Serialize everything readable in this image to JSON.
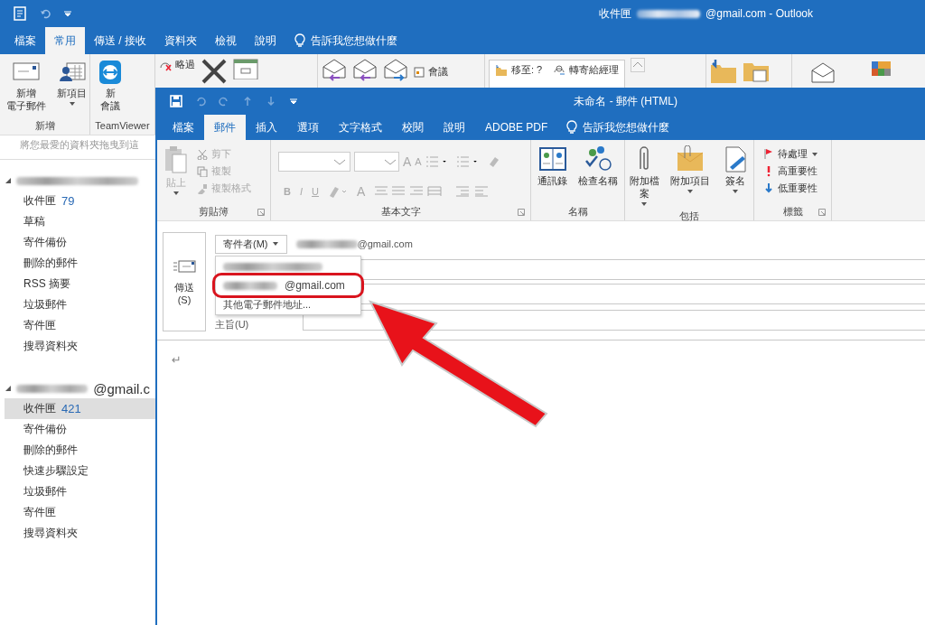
{
  "outlook": {
    "title": {
      "folder": "收件匣",
      "account": "@gmail.com - Outlook"
    },
    "tabs": [
      {
        "label": "檔案",
        "selected": false
      },
      {
        "label": "常用",
        "selected": true
      },
      {
        "label": "傳送 / 接收",
        "selected": false
      },
      {
        "label": "資料夾",
        "selected": false
      },
      {
        "label": "檢視",
        "selected": false
      },
      {
        "label": "說明",
        "selected": false
      }
    ],
    "tell_me": "告訴我您想做什麼",
    "ribbon": {
      "groups": [
        {
          "kind": "new",
          "label": "新增",
          "buttons": [
            {
              "kind": "mail",
              "label_lines": [
                "新增",
                "電子郵件"
              ],
              "menu": false
            },
            {
              "kind": "item",
              "label_lines": [
                "新項目"
              ],
              "menu": true
            }
          ]
        },
        {
          "kind": "teamviewer",
          "label": "TeamViewer",
          "buttons": [
            {
              "kind": "meeting",
              "label_lines": [
                "新",
                "會議"
              ],
              "menu": false
            }
          ]
        }
      ],
      "ignore": "略過",
      "meeting": "會議",
      "quick_steps": [
        "移至: ?",
        "轉寄給經理"
      ]
    },
    "favorites_hint": "將您最愛的資料夾拖曳到這",
    "accounts": [
      {
        "expanded": true,
        "folders": [
          {
            "name": "收件匣",
            "count": "79",
            "selected": false
          },
          {
            "name": "草稿",
            "selected": false
          },
          {
            "name": "寄件備份",
            "selected": false
          },
          {
            "name": "刪除的郵件",
            "selected": false
          },
          {
            "name": "RSS 摘要",
            "selected": false
          },
          {
            "name": "垃圾郵件",
            "selected": false
          },
          {
            "name": "寄件匣",
            "selected": false
          },
          {
            "name": "搜尋資料夾",
            "selected": false
          }
        ]
      },
      {
        "expanded": true,
        "name": "@gmail.c",
        "folders": [
          {
            "name": "收件匣",
            "count": "421",
            "selected": true
          },
          {
            "name": "寄件備份",
            "selected": false
          },
          {
            "name": "刪除的郵件",
            "selected": false
          },
          {
            "name": "快速步驟設定",
            "selected": false
          },
          {
            "name": "垃圾郵件",
            "selected": false
          },
          {
            "name": "寄件匣",
            "selected": false
          },
          {
            "name": "搜尋資料夾",
            "selected": false
          }
        ]
      }
    ]
  },
  "compose": {
    "title": "未命名 - 郵件 (HTML)",
    "tabs": [
      {
        "label": "檔案",
        "selected": false
      },
      {
        "label": "郵件",
        "selected": true
      },
      {
        "label": "插入",
        "selected": false
      },
      {
        "label": "選項",
        "selected": false
      },
      {
        "label": "文字格式",
        "selected": false
      },
      {
        "label": "校閱",
        "selected": false
      },
      {
        "label": "說明",
        "selected": false
      },
      {
        "label": "ADOBE PDF",
        "selected": false
      }
    ],
    "tell_me": "告訴我您想做什麼",
    "clipboard": {
      "label": "剪貼簿",
      "disabled": true,
      "paste": "貼上",
      "actions": [
        "剪下",
        "複製",
        "複製格式"
      ]
    },
    "basic_text": {
      "label": "基本文字",
      "disabled": true,
      "grow": "A",
      "shrink": "A",
      "styles": [
        "B",
        "I",
        "U"
      ],
      "font_color": "A"
    },
    "names": {
      "label": "名稱",
      "buttons": [
        "通訊錄",
        "檢查名稱"
      ]
    },
    "include": {
      "label": "包括",
      "buttons": [
        {
          "label_lines": [
            "附加檔",
            "案"
          ],
          "menu": true
        },
        {
          "label_lines": [
            "附加項目"
          ],
          "menu": true
        },
        {
          "label_lines": [
            "簽名"
          ],
          "menu": true
        }
      ]
    },
    "tags": {
      "label": "標籤",
      "items": [
        {
          "kind": "flag",
          "label": "待處理",
          "menu": true
        },
        {
          "kind": "high",
          "label": "高重要性",
          "menu": false
        },
        {
          "kind": "low",
          "label": "低重要性",
          "menu": false
        }
      ]
    },
    "send": "傳送(S)",
    "from_button": "寄件者(M)",
    "from_address": "@gmail.com",
    "from_menu": [
      {
        "kind": "redacted",
        "highlighted": false
      },
      {
        "kind": "address",
        "text": "@gmail.com",
        "highlighted": true
      },
      {
        "kind": "other",
        "text": "其他電子郵件地址...",
        "highlighted": false
      }
    ],
    "subject_label": "主旨(U)",
    "body_mark": "↵"
  }
}
